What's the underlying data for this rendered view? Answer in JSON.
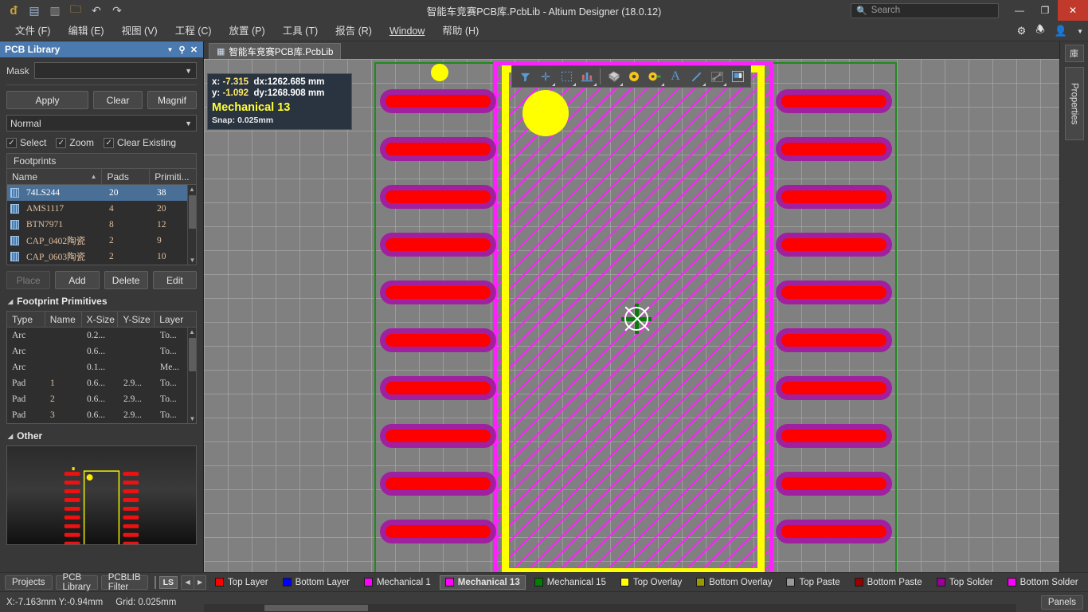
{
  "titlebar": {
    "title": "智能车竞赛PCB库.PcbLib - Altium Designer (18.0.12)",
    "quick_access": [
      {
        "name": "altium-logo-icon",
        "glyph": "ð"
      },
      {
        "name": "save-icon",
        "glyph": "▤"
      },
      {
        "name": "save-all-icon",
        "glyph": "▥"
      },
      {
        "name": "open-folder-icon",
        "glyph": "📂"
      },
      {
        "name": "undo-icon",
        "glyph": "↶"
      },
      {
        "name": "redo-icon",
        "glyph": "↷"
      }
    ],
    "search_placeholder": "Search",
    "search_icon": "search-icon",
    "minimize": "—",
    "restore": "❐",
    "close": "✕"
  },
  "menubar": {
    "items": [
      {
        "label": "文件 (F)"
      },
      {
        "label": "编辑 (E)"
      },
      {
        "label": "视图 (V)"
      },
      {
        "label": "工程 (C)"
      },
      {
        "label": "放置 (P)"
      },
      {
        "label": "工具 (T)"
      },
      {
        "label": "报告 (R)"
      },
      {
        "label": "Window"
      },
      {
        "label": "帮助 (H)"
      }
    ],
    "right_icons": [
      {
        "name": "settings-gear-icon",
        "glyph": "⚙"
      },
      {
        "name": "notifications-bell-icon",
        "glyph": "🔔"
      },
      {
        "name": "user-account-icon",
        "glyph": "👤"
      },
      {
        "name": "chevron-down-icon",
        "glyph": "▾"
      }
    ]
  },
  "pcb_library_panel": {
    "title": "PCB Library",
    "header_icons": [
      {
        "name": "panel-dropdown-icon",
        "glyph": "▼"
      },
      {
        "name": "pin-panel-icon",
        "glyph": "📌"
      },
      {
        "name": "close-panel-icon",
        "glyph": "✕"
      }
    ],
    "mask_label": "Mask",
    "mask_value": "",
    "apply_label": "Apply",
    "clear_label": "Clear",
    "magnify_label": "Magnif",
    "mode_value": "Normal",
    "checkboxes": [
      {
        "label": "Select",
        "checked": true
      },
      {
        "label": "Zoom",
        "checked": true
      },
      {
        "label": "Clear Existing",
        "checked": true
      }
    ],
    "footprints_section_title": "Footprints",
    "footprints_columns": [
      "Name",
      "Pads",
      "Primiti..."
    ],
    "footprints_rows": [
      {
        "name": "74LS244",
        "pads": "20",
        "primitives": "38",
        "selected": true
      },
      {
        "name": "AMS1117",
        "pads": "4",
        "primitives": "20",
        "selected": false
      },
      {
        "name": "BTN7971",
        "pads": "8",
        "primitives": "12",
        "selected": false
      },
      {
        "name": "CAP_0402陶瓷",
        "pads": "2",
        "primitives": "9",
        "selected": false
      },
      {
        "name": "CAP_0603陶瓷",
        "pads": "2",
        "primitives": "10",
        "selected": false
      }
    ],
    "action_buttons": [
      {
        "label": "Place",
        "disabled": true
      },
      {
        "label": "Add",
        "disabled": false
      },
      {
        "label": "Delete",
        "disabled": false
      },
      {
        "label": "Edit",
        "disabled": false
      }
    ],
    "primitives_section_title": "Footprint Primitives",
    "primitives_columns": [
      "Type",
      "Name",
      "X-Size",
      "Y-Size",
      "Layer"
    ],
    "primitives_rows": [
      {
        "type": "Arc",
        "name": "",
        "xsize": "0.2...",
        "ysize": "",
        "layer": "To..."
      },
      {
        "type": "Arc",
        "name": "",
        "xsize": "0.6...",
        "ysize": "",
        "layer": "To..."
      },
      {
        "type": "Arc",
        "name": "",
        "xsize": "0.1...",
        "ysize": "",
        "layer": "Me..."
      },
      {
        "type": "Pad",
        "name": "1",
        "xsize": "0.6...",
        "ysize": "2.9...",
        "layer": "To..."
      },
      {
        "type": "Pad",
        "name": "2",
        "xsize": "0.6...",
        "ysize": "2.9...",
        "layer": "To..."
      },
      {
        "type": "Pad",
        "name": "3",
        "xsize": "0.6...",
        "ysize": "2.9...",
        "layer": "To..."
      }
    ],
    "other_section_title": "Other"
  },
  "document_tab": {
    "label": "智能车竞赛PCB库.PcbLib",
    "icon": "pcb-document-icon"
  },
  "hud": {
    "x_label": "x:",
    "x_value": "-7.315",
    "dx_label": "dx:1262.685  mm",
    "y_label": "y:",
    "y_value": "-1.092",
    "dy_label": "dy:1268.908  mm",
    "layer": "Mechanical 13",
    "snap": "Snap: 0.025mm"
  },
  "canvas_toolbar": {
    "tools": [
      {
        "name": "filter-funnel-icon",
        "glyph": "▼",
        "color": "#5b9bd5",
        "corner": false
      },
      {
        "name": "crosshair-icon",
        "glyph": "✛",
        "color": "#5b9bd5",
        "corner": true
      },
      {
        "name": "selection-rect-icon",
        "glyph": "▭",
        "color": "#5b9bd5",
        "corner": true
      },
      {
        "name": "align-chart-icon",
        "glyph": "▥",
        "color": "#d08080",
        "corner": true
      },
      {
        "name": "place-component-icon",
        "glyph": "▰",
        "color": "#cfcfcf",
        "corner": true
      },
      {
        "name": "place-via-icon",
        "glyph": "◉",
        "color": "#ffcc00",
        "corner": false
      },
      {
        "name": "place-pad-icon",
        "glyph": "◉",
        "color": "#ffcc00",
        "corner": true
      },
      {
        "name": "place-text-icon",
        "glyph": "A",
        "color": "#5b9bd5",
        "corner": false
      },
      {
        "name": "place-line-icon",
        "glyph": "╱",
        "color": "#5b9bd5",
        "corner": true
      },
      {
        "name": "place-dimension-icon",
        "glyph": "⤢",
        "color": "#9a9a9a",
        "corner": true
      },
      {
        "name": "place-board-cutout-icon",
        "glyph": "◳",
        "color": "#5b9bd5",
        "corner": false
      }
    ]
  },
  "canvas": {
    "pad_count_per_side": 10,
    "pad_fill": "#ff0000",
    "pad_mask": "#a020a0",
    "mechanical_outline_color": "#ff20ff",
    "overlay_color": "#ffff00",
    "boundary_color": "#1f8a1f",
    "via_color": "#ffff00",
    "background": "#808080"
  },
  "right_edge": {
    "library_icon": "library-panel-icon",
    "properties_tab": "Properties"
  },
  "panel_bar": {
    "panels": [
      "Projects",
      "PCB Library",
      "PCBLIB Filter"
    ],
    "active_color_chip": "#ff00ff",
    "ls_label": "LS",
    "nav_prev": "◀",
    "nav_next": "▶",
    "layers": [
      {
        "label": "Top Layer",
        "color": "#ff0000",
        "active": false
      },
      {
        "label": "Bottom Layer",
        "color": "#0000ff",
        "active": false
      },
      {
        "label": "Mechanical 1",
        "color": "#ff00ff",
        "active": false
      },
      {
        "label": "Mechanical 13",
        "color": "#ff00ff",
        "active": true
      },
      {
        "label": "Mechanical 15",
        "color": "#008000",
        "active": false
      },
      {
        "label": "Top Overlay",
        "color": "#ffff00",
        "active": false
      },
      {
        "label": "Bottom Overlay",
        "color": "#999900",
        "active": false
      },
      {
        "label": "Top Paste",
        "color": "#999999",
        "active": false
      },
      {
        "label": "Bottom Paste",
        "color": "#990000",
        "active": false
      },
      {
        "label": "Top Solder",
        "color": "#990099",
        "active": false
      },
      {
        "label": "Bottom Solder",
        "color": "#ff00ff",
        "active": false
      }
    ]
  },
  "status_bar": {
    "coordinates": "X:-7.163mm Y:-0.94mm",
    "grid": "Grid: 0.025mm",
    "panels_button": "Panels"
  }
}
